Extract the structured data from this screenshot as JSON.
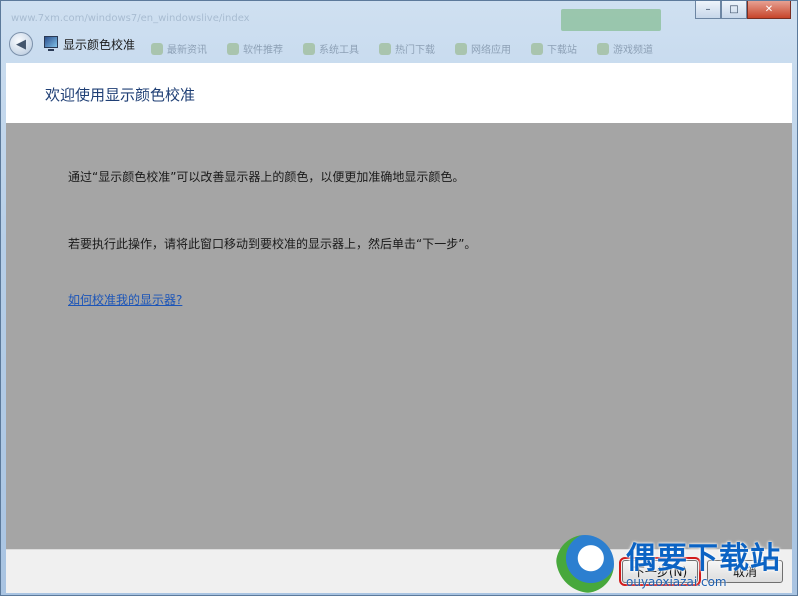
{
  "window": {
    "title": "显示颜色校准",
    "back_icon": "back-arrow-icon",
    "minimize_glyph": "–",
    "maximize_glyph": "□",
    "close_glyph": "✕"
  },
  "background": {
    "ghost_url": "www.7xm.com/windows7/en_windowslive/index",
    "ghost_bookmarks": [
      "最新资讯",
      "软件推荐",
      "系统工具",
      "热门下载",
      "网络应用",
      "下载站",
      "游戏频道"
    ]
  },
  "header": {
    "heading": "欢迎使用显示颜色校准"
  },
  "content": {
    "paragraph1": "通过“显示颜色校准”可以改善显示器上的颜色，以便更加准确地显示颜色。",
    "paragraph2": "若要执行此操作，请将此窗口移动到要校准的显示器上，然后单击“下一步”。",
    "help_link": "如何校准我的显示器?"
  },
  "footer": {
    "next_label": "下一步(N)",
    "cancel_label": "取消"
  },
  "watermark": {
    "text": "偶要下载站",
    "url": "ouyaoxiazai.com"
  },
  "colors": {
    "heading": "#1f3f75",
    "link": "#1c55b8",
    "body_bg": "#a5a5a5",
    "highlight": "#d21a1a"
  }
}
